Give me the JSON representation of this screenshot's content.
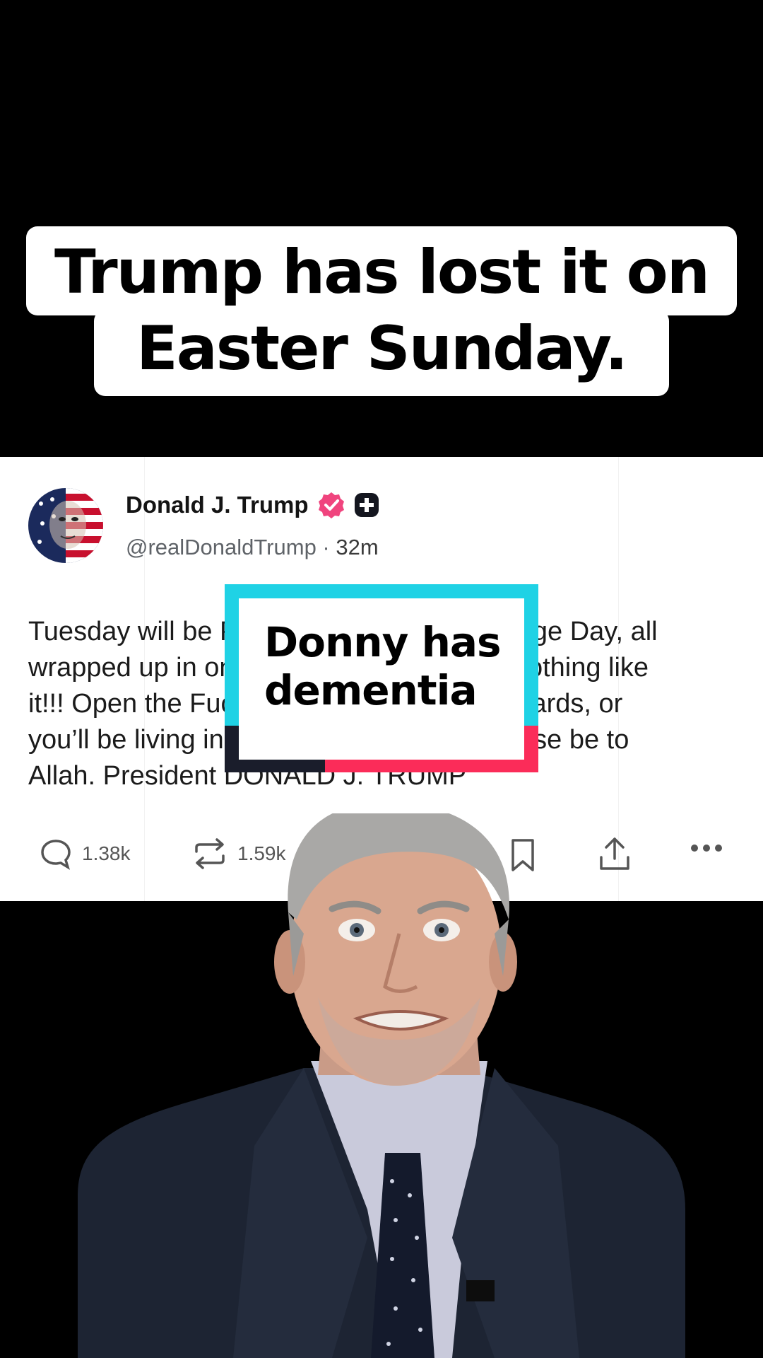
{
  "caption": {
    "line1": "Trump has lost it on",
    "line2": "Easter Sunday."
  },
  "tweet": {
    "name": "Donald J. Trump",
    "handle": "@realDonaldTrump",
    "separator": " · ",
    "time": "32m",
    "text_lines": [
      "Tuesday will be Power Plant Day, and Bridge Day, all",
      "wrapped up in one, in Iran. There will be nothing like",
      "it!!! Open the Fuckin’ Strait, you crazy bastards, or",
      "you’ll be living in Hell - JUST WATCH! Praise be to",
      "Allah. President DONALD J. TRUMP"
    ],
    "replies": "1.38k",
    "reposts": "1.59k",
    "icons": [
      "verified-badge-icon",
      "plus-badge-icon",
      "reply-icon",
      "repost-icon",
      "bookmark-icon",
      "share-icon",
      "more-icon"
    ],
    "colors": {
      "verified": "#f0447e"
    }
  },
  "sticker": {
    "line1": "Donny has",
    "line2": "dementia",
    "colors": {
      "cyan": "#1fd2e5",
      "pink": "#fb2c59",
      "dark": "#1a1d2b"
    }
  }
}
